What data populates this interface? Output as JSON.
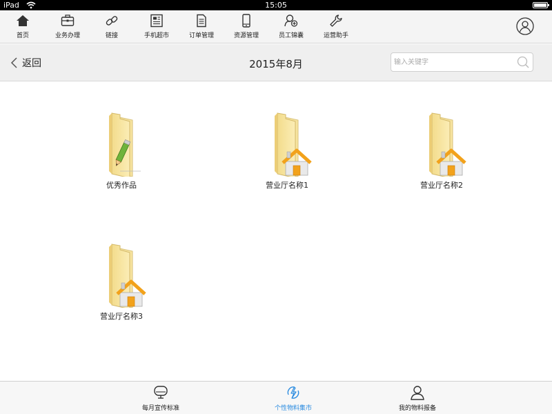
{
  "status_bar": {
    "device": "iPad",
    "time": "15:05"
  },
  "top_nav": {
    "items": [
      {
        "label": "首页",
        "icon": "home-icon"
      },
      {
        "label": "业务办理",
        "icon": "briefcase-icon"
      },
      {
        "label": "链接",
        "icon": "link-icon"
      },
      {
        "label": "手机超市",
        "icon": "newspaper-icon"
      },
      {
        "label": "订单管理",
        "icon": "document-icon"
      },
      {
        "label": "资源管理",
        "icon": "phone-icon"
      },
      {
        "label": "员工锦囊",
        "icon": "staff-icon"
      },
      {
        "label": "运营助手",
        "icon": "wrench-icon"
      }
    ],
    "avatar_icon": "user-avatar-icon"
  },
  "sub_header": {
    "back_label": "返回",
    "title": "2015年8月",
    "search_placeholder": "输入关键字"
  },
  "folders": [
    {
      "label": "优秀作品",
      "badge": "pencil-icon"
    },
    {
      "label": "营业厅名称1",
      "badge": "house-icon"
    },
    {
      "label": "营业厅名称2",
      "badge": "house-icon"
    },
    {
      "label": "营业厅名称3",
      "badge": "house-icon"
    }
  ],
  "tab_bar": {
    "tabs": [
      {
        "label": "每月宣传标准",
        "icon": "monitor-icon"
      },
      {
        "label": "个性物料集市",
        "icon": "lightning-icon",
        "active": true
      },
      {
        "label": "我的物料报备",
        "icon": "person-icon"
      }
    ],
    "active_color": "#2a8be0"
  }
}
